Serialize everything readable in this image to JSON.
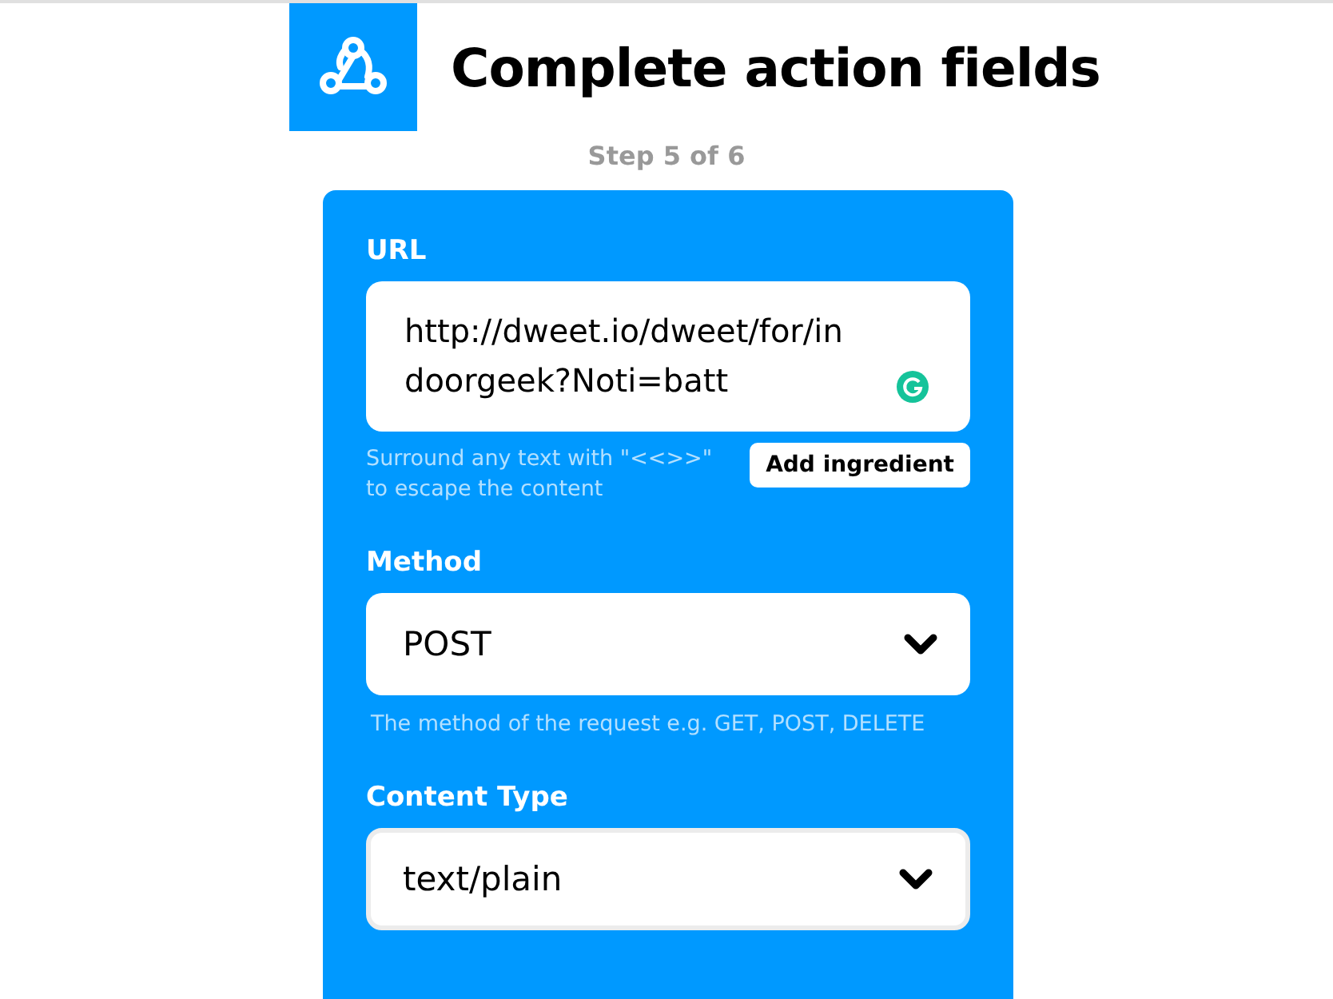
{
  "header": {
    "title": "Complete action fields",
    "step": "Step 5 of 6"
  },
  "fields": [
    {
      "kind": "text",
      "label": "URL",
      "value": "http://dweet.io/dweet/for/indoorgeek?Noti=batt",
      "helper": "Surround any text with \"<<>>\" to escape the content",
      "button": "Add ingredient",
      "focused": false
    },
    {
      "kind": "select",
      "label": "Method",
      "value": "POST",
      "helper": "The method of the request e.g. GET, POST, DELETE",
      "focused": false
    },
    {
      "kind": "select",
      "label": "Content Type",
      "value": "text/plain",
      "focused": true
    }
  ]
}
